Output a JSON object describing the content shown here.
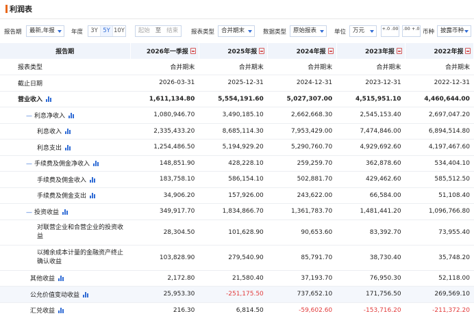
{
  "title": "利润表",
  "filters": {
    "period_label": "报告期",
    "period_value": "最新,年报",
    "year_label": "年度",
    "year_buttons": [
      "3Y",
      "5Y",
      "10Y"
    ],
    "year_active": "5Y",
    "range_start": "起始",
    "range_to": "至",
    "range_end": "结束",
    "report_type_label": "报表类型",
    "report_type_value": "合并期末",
    "data_type_label": "数据类型",
    "data_type_value": "原始报表",
    "unit_label": "单位",
    "unit_value": "万元",
    "dec_plus": "+.0 .00",
    "dec_minus": ".00 +.0",
    "currency_label": "币种",
    "currency_value": "披露币种"
  },
  "table": {
    "header": [
      "报告期",
      "2026年一季报",
      "2025年报",
      "2024年报",
      "2023年报",
      "2022年报"
    ],
    "rows": [
      {
        "label": "报表类型",
        "values": [
          "合并期末",
          "合并期末",
          "合并期末",
          "合并期末",
          "合并期末"
        ]
      },
      {
        "label": "截止日期",
        "values": [
          "2026-03-31",
          "2025-12-31",
          "2024-12-31",
          "2023-12-31",
          "2022-12-31"
        ]
      },
      {
        "label": "营业收入",
        "values": [
          "1,611,134.80",
          "5,554,191.60",
          "5,027,307.00",
          "4,515,951.10",
          "4,460,644.00"
        ]
      },
      {
        "label": "利息净收入",
        "values": [
          "1,080,946.70",
          "3,490,185.10",
          "2,662,668.30",
          "2,545,153.40",
          "2,697,047.20"
        ]
      },
      {
        "label": "利息收入",
        "values": [
          "2,335,433.20",
          "8,685,114.30",
          "7,953,429.00",
          "7,474,846.00",
          "6,894,514.80"
        ]
      },
      {
        "label": "利息支出",
        "values": [
          "1,254,486.50",
          "5,194,929.20",
          "5,290,760.70",
          "4,929,692.60",
          "4,197,467.60"
        ]
      },
      {
        "label": "手续费及佣金净收入",
        "values": [
          "148,851.90",
          "428,228.10",
          "259,259.70",
          "362,878.60",
          "534,404.10"
        ]
      },
      {
        "label": "手续费及佣金收入",
        "values": [
          "183,758.10",
          "586,154.10",
          "502,881.70",
          "429,462.60",
          "585,512.50"
        ]
      },
      {
        "label": "手续费及佣金支出",
        "values": [
          "34,906.20",
          "157,926.00",
          "243,622.00",
          "66,584.00",
          "51,108.40"
        ]
      },
      {
        "label": "投资收益",
        "values": [
          "349,917.70",
          "1,834,866.70",
          "1,361,783.70",
          "1,481,441.20",
          "1,096,766.80"
        ]
      },
      {
        "label": "对联营企业和合营企业的投资收益",
        "values": [
          "28,304.50",
          "101,628.90",
          "90,653.60",
          "83,392.70",
          "73,955.40"
        ]
      },
      {
        "label": "以摊余成本计量的金融资产终止确认收益",
        "values": [
          "103,828.90",
          "279,540.90",
          "85,791.70",
          "38,730.40",
          "35,748.20"
        ]
      },
      {
        "label": "其他收益",
        "values": [
          "2,172.80",
          "21,580.40",
          "37,193.70",
          "76,950.30",
          "52,118.00"
        ]
      },
      {
        "label": "公允价值变动收益",
        "values": [
          "25,953.30",
          "-251,175.50",
          "737,652.10",
          "171,756.50",
          "269,569.10"
        ]
      },
      {
        "label": "汇兑收益",
        "values": [
          "216.30",
          "6,814.50",
          "-59,602.60",
          "-153,716.20",
          "-211,372.20"
        ]
      }
    ]
  },
  "colors": {
    "accent": "#e9671b",
    "link": "#2f6bd5",
    "negative": "#e23b3b",
    "header_bg": "#f0f4fb"
  },
  "icons": {
    "report_pdf": "pdf-icon",
    "trend": "bar-chart-icon"
  }
}
